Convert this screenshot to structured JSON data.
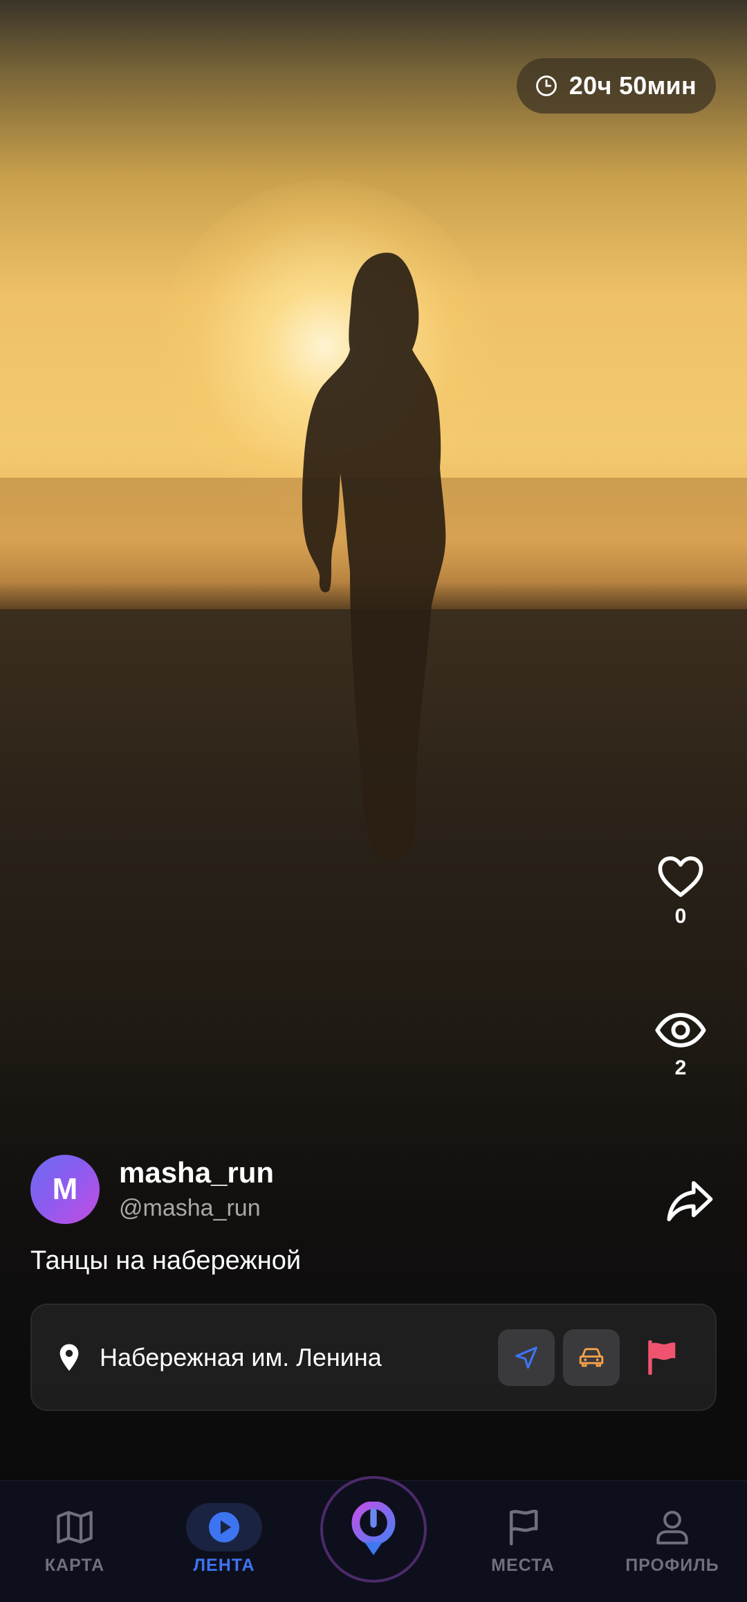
{
  "status": {
    "timer_text": "20ч 50мин"
  },
  "post": {
    "likes": "0",
    "views": "2",
    "author": {
      "avatar_letter": "M",
      "name": "masha_run",
      "handle": "@masha_run"
    },
    "caption": "Танцы на набережной",
    "location": {
      "name": "Набережная им. Ленина"
    }
  },
  "nav": {
    "items": [
      {
        "label": "КАРТА",
        "icon": "map-icon",
        "active": false
      },
      {
        "label": "ЛЕНТА",
        "icon": "play-icon",
        "active": true
      },
      {
        "label": "",
        "icon": "app-logo-icon",
        "active": false
      },
      {
        "label": "МЕСТА",
        "icon": "flag-icon",
        "active": false
      },
      {
        "label": "ПРОФИЛЬ",
        "icon": "user-icon",
        "active": false
      }
    ]
  },
  "colors": {
    "accent": "#3d74f2",
    "flag": "#f0536e",
    "car": "#f5a14a",
    "avatar_gradient": [
      "#6d6cf2",
      "#c24ee0"
    ]
  }
}
